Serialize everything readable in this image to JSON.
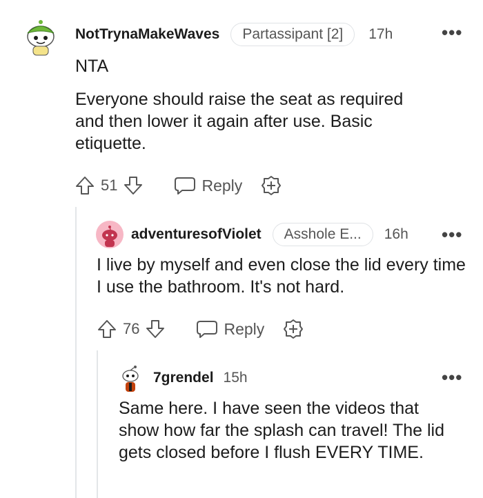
{
  "comments": [
    {
      "username": "NotTrynaMakeWaves",
      "flair": "Partassipant [2]",
      "time": "17h",
      "paragraphs": [
        "NTA",
        "Everyone should raise the seat as required and then lower it again after use. Basic etiquette."
      ],
      "votes": "51",
      "reply_label": "Reply",
      "avatar_colors": {
        "bg": "#ffffff",
        "accent": "#6fb83a"
      }
    },
    {
      "username": "adventuresofViolet",
      "flair": "Asshole E...",
      "time": "16h",
      "paragraphs": [
        "I live by myself and even close the lid every time I use the bathroom. It's not hard."
      ],
      "votes": "76",
      "reply_label": "Reply",
      "avatar_colors": {
        "bg": "#f7b7c5",
        "accent": "#c2344f"
      }
    },
    {
      "username": "7grendel",
      "time": "15h",
      "paragraphs": [
        "Same here. I have seen the videos that show how far the splash can travel! The lid gets closed before I flush EVERY TIME."
      ],
      "avatar_colors": {
        "bg": "#ffffff",
        "accent": "#c2410c"
      }
    }
  ],
  "icons": {
    "more": "more-options-icon",
    "upvote": "upvote-arrow-icon",
    "downvote": "downvote-arrow-icon",
    "reply": "speech-bubble-icon",
    "award": "award-plus-icon"
  }
}
